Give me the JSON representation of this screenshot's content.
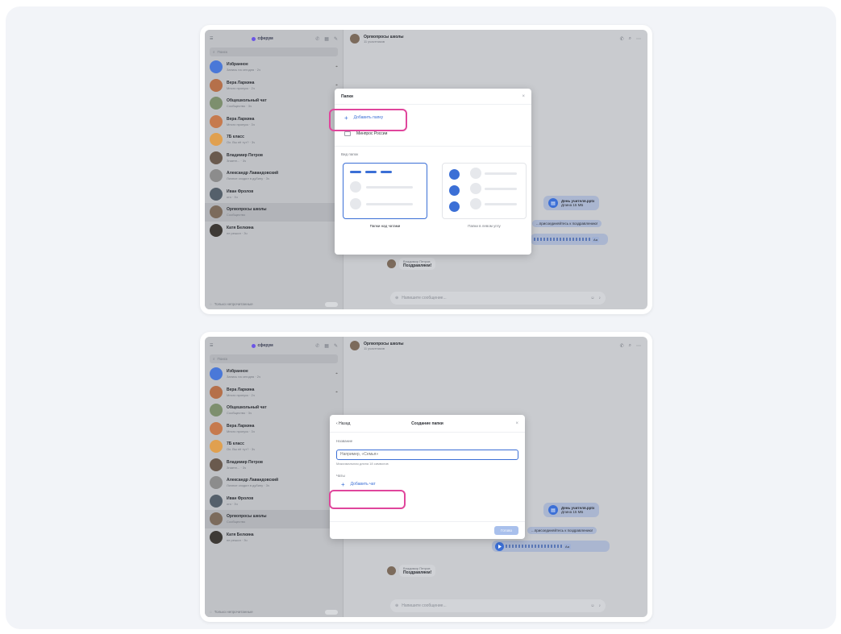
{
  "colors": {
    "accent": "#3b6fd6",
    "highlight": "#e0469c",
    "brand": "#6b55e6"
  },
  "app": {
    "brand": "сферум",
    "search_placeholder": "Поиск",
    "only_unread": "Только непрочитанные",
    "chat_header_name": "Оргвопросы школы",
    "chat_header_sub": "11 участников",
    "composer_placeholder": "Напишите сообщение...",
    "chats": [
      {
        "name": "Избранное",
        "preview": "Запись на сегодня · 2ч",
        "avatar_color": "#4a78d8"
      },
      {
        "name": "Вера Ларкина",
        "preview": "Много пропуск · 2ч",
        "avatar_color": "#b5704a"
      },
      {
        "name": "Общешкольный чат",
        "preview": "Сообщество · 3ч",
        "avatar_color": "#7d8f6e"
      },
      {
        "name": "Вера Ларкина",
        "preview": "Много пропуск · 3ч",
        "avatar_color": "#c67a4e"
      },
      {
        "name": "7Б класс",
        "preview": "Ох. Вы её тут? · 3ч",
        "avatar_color": "#e0a04f"
      },
      {
        "name": "Владимир Петров",
        "preview": "Знаете... · 3ч",
        "avatar_color": "#6a5a4e"
      },
      {
        "name": "Александр Лавандовский",
        "preview": "Личное сходил в дубину · 3ч",
        "avatar_color": "#8c8c8c"
      },
      {
        "name": "Иван Фролов",
        "preview": "ого · 3ч",
        "avatar_color": "#55606b"
      },
      {
        "name": "Оргвопросы школы",
        "preview": "Сообщество",
        "avatar_color": "#7c6b5c"
      },
      {
        "name": "Катя Белкина",
        "preview": "не решил · 3ч",
        "avatar_color": "#3e3a36"
      }
    ],
    "messages": {
      "file_name": "День учителя.pptx",
      "file_meta": "Длина 15 МБ",
      "congrats_line": "...присоединяйтесь к поздравлению!",
      "voice_tag": "Аа",
      "author": "Владимир Петров",
      "congrats": "Поздравляем!"
    }
  },
  "modal_folders": {
    "title": "Папки",
    "close": "×",
    "add_folder": "Добавить папку",
    "folder_item": "Минпрос России",
    "view_label": "Вид папок",
    "view_over_chats": "Папки над чатами",
    "view_side": "Папки в левом углу"
  },
  "modal_create": {
    "back": "Назад",
    "title": "Создание папки",
    "close": "×",
    "name_label": "Название",
    "name_placeholder": "Например, «Семья»",
    "hint": "Максимальная длина 18 символов",
    "chats_label": "Чаты",
    "add_chat": "Добавить чат",
    "done": "Готово"
  }
}
